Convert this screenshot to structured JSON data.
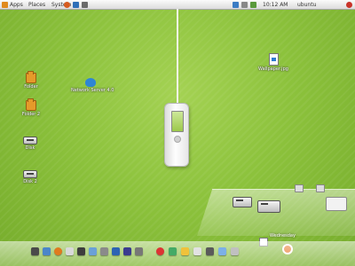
{
  "top_panel": {
    "menus": [
      "Apps",
      "Places",
      "System"
    ],
    "status_text": "10:12 AM",
    "user": "ubuntu"
  },
  "desktop": {
    "icons": [
      {
        "label": "Folder"
      },
      {
        "label": "Folder 2"
      },
      {
        "label": "Disk"
      },
      {
        "label": "Disk 2"
      },
      {
        "label": "Network Server 4.0"
      },
      {
        "label": "Wallpaper.jpg"
      }
    ]
  },
  "shelf": {
    "caption": "Wednesday"
  },
  "colors": {
    "wallpaper": "#8cc23c",
    "folder": "#e59a2a"
  }
}
